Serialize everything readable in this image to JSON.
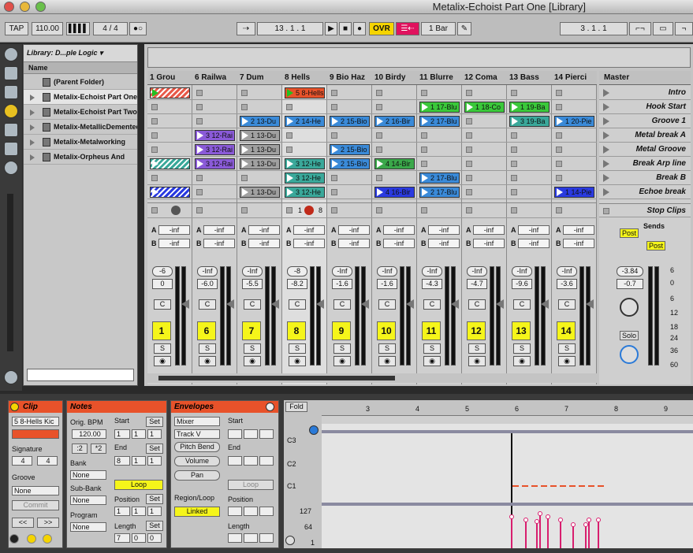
{
  "window": {
    "title": "Metalix-Echoist Part One  [Library]"
  },
  "control": {
    "tap": "TAP",
    "bpm": "110.00",
    "sig": "4 / 4",
    "position": "13 .  1 .  1",
    "ovr": "OVR",
    "quant": "1 Bar",
    "loop_pos": "3 .  1 .  1",
    "colors": {
      "ovr": "#f5d400",
      "rec": "#e0125e"
    }
  },
  "library": {
    "title": "Library: D...ple Logic",
    "column": "Name",
    "items": [
      "(Parent Folder)",
      "Metalix-Echoist Part One",
      "Metalix-Echoist Part Two",
      "Metalix-MetallicDemented",
      "Metalix-Metalworking",
      "Metalix-Orpheus And"
    ]
  },
  "tracks": [
    {
      "name": "1 Grou",
      "num": "1",
      "vol": "-6",
      "pan": "0",
      "clips": [
        {
          "t": "",
          "c": "#e85a4a",
          "hatch": true,
          "playing": true
        },
        null,
        null,
        null,
        null,
        {
          "t": "",
          "c": "#3aa89a",
          "hatch": true
        },
        null,
        {
          "t": "",
          "c": "#2a3ae0",
          "hatch": true
        }
      ]
    },
    {
      "name": "6 Railwa",
      "num": "6",
      "vol": "-Inf",
      "pan": "-6.0",
      "clips": [
        null,
        null,
        null,
        {
          "t": "3 12-Rai",
          "c": "#8a5ad8"
        },
        {
          "t": "3 12-Rai",
          "c": "#8a5ad8"
        },
        {
          "t": "3 12-Rai",
          "c": "#8a5ad8"
        },
        null,
        null
      ]
    },
    {
      "name": "7 Dum",
      "num": "7",
      "vol": "-Inf",
      "pan": "-5.5",
      "clips": [
        null,
        null,
        {
          "t": "2 13-Du",
          "c": "#3a8ad8"
        },
        {
          "t": "1 13-Du",
          "c": "#a0a0a0"
        },
        {
          "t": "1 13-Du",
          "c": "#a0a0a0"
        },
        {
          "t": "1 13-Du",
          "c": "#a0a0a0"
        },
        null,
        {
          "t": "1 13-Du",
          "c": "#a0a0a0"
        }
      ]
    },
    {
      "name": "8 Hells",
      "num": "8",
      "vol": "-8",
      "pan": "-8.2",
      "clips": [
        {
          "t": "5 8-Hells",
          "c": "#e8522a",
          "playing": true
        },
        null,
        {
          "t": "2 14-He",
          "c": "#3a8ad8"
        },
        null,
        null,
        {
          "t": "3 12-He",
          "c": "#3aa89a"
        },
        {
          "t": "3 12-He",
          "c": "#3aa89a"
        },
        {
          "t": "3 12-He",
          "c": "#3aa89a"
        }
      ]
    },
    {
      "name": "9 Bio Haz",
      "num": "9",
      "vol": "-Inf",
      "pan": "-1.6",
      "clips": [
        null,
        null,
        {
          "t": "2 15-Bio",
          "c": "#3a8ad8"
        },
        null,
        {
          "t": "2 15-Bio",
          "c": "#3a8ad8"
        },
        {
          "t": "2 15-Bio",
          "c": "#3a8ad8"
        },
        null,
        null
      ]
    },
    {
      "name": "10 Birdy",
      "num": "10",
      "vol": "-Inf",
      "pan": "-1.6",
      "clips": [
        null,
        null,
        {
          "t": "2 16-Bir",
          "c": "#3a8ad8"
        },
        null,
        null,
        {
          "t": "4 14-Bir",
          "c": "#3aa84a"
        },
        null,
        {
          "t": "4 16-Bir",
          "c": "#2a3ae0"
        }
      ]
    },
    {
      "name": "11 Blurre",
      "num": "11",
      "vol": "-Inf",
      "pan": "-4.3",
      "clips": [
        null,
        {
          "t": "1 17-Blu",
          "c": "#3ac83a"
        },
        {
          "t": "2 17-Blu",
          "c": "#3a8ad8"
        },
        null,
        null,
        null,
        {
          "t": "2 17-Blu",
          "c": "#3a8ad8"
        },
        {
          "t": "2 17-Blu",
          "c": "#3a8ad8"
        }
      ]
    },
    {
      "name": "12 Coma",
      "num": "12",
      "vol": "-Inf",
      "pan": "-4.7",
      "clips": [
        null,
        {
          "t": "1 18-Co",
          "c": "#3ac83a"
        },
        null,
        null,
        null,
        null,
        null,
        null
      ]
    },
    {
      "name": "13 Bass",
      "num": "13",
      "vol": "-Inf",
      "pan": "-9.6",
      "clips": [
        null,
        {
          "t": "1 19-Ba",
          "c": "#3ac83a"
        },
        {
          "t": "3 19-Ba",
          "c": "#3aa89a"
        },
        null,
        null,
        null,
        null,
        null
      ]
    },
    {
      "name": "14 Pierci",
      "num": "14",
      "vol": "-Inf",
      "pan": "-3.6",
      "clips": [
        null,
        null,
        {
          "t": "1 20-Pie",
          "c": "#3a8ad8"
        },
        null,
        null,
        null,
        null,
        {
          "t": "1 14-Pie",
          "c": "#2a3ae0"
        }
      ]
    }
  ],
  "sends": {
    "a": "A",
    "b": "B",
    "value": "-inf",
    "c": "C",
    "s": "S"
  },
  "master": {
    "name": "Master",
    "scenes": [
      "Intro",
      "Hook Start",
      "Groove 1",
      "Metal break A",
      "Metal Groove",
      "Break Arp line",
      "Break B",
      "Echoe break"
    ],
    "stop": "Stop Clips",
    "sends": "Sends",
    "post": "Post",
    "vol": "-3.84",
    "pan": "-0.7",
    "solo": "Solo",
    "scale": [
      "6",
      "0",
      "6",
      "12",
      "18",
      "24",
      "36",
      "60"
    ]
  },
  "hells_ctrl": {
    "a": "1",
    "b": "8"
  },
  "clip": {
    "title": "Clip",
    "name": "5 8-Hells Kic",
    "sig_label": "Signature",
    "sig_num": "4",
    "sig_den": "4",
    "groove": "Groove",
    "groove_val": "None",
    "commit": "Commit"
  },
  "notes": {
    "title": "Notes",
    "bpm_label": "Orig. BPM",
    "bpm": "120.00",
    "half": ":2",
    "dbl": "*2",
    "bank": "Bank",
    "sub": "Sub-Bank",
    "prog": "Program",
    "none": "None",
    "start": "Start",
    "end": "End",
    "set": "Set",
    "loop": "Loop",
    "position": "Position",
    "length": "Length",
    "s1": "1",
    "e1": "8",
    "l1": "7",
    "z": "0"
  },
  "env": {
    "title": "Envelopes",
    "mixer": "Mixer",
    "track": "Track V",
    "pitch": "Pitch Bend",
    "volume": "Volume",
    "pan": "Pan",
    "region": "Region/Loop",
    "linked": "Linked",
    "start": "Start",
    "end": "End",
    "loop": "Loop",
    "position": "Position",
    "length": "Length"
  },
  "editor": {
    "fold": "Fold",
    "bars": [
      "3",
      "4",
      "5",
      "6",
      "7",
      "8",
      "9"
    ],
    "keys": [
      "C3",
      "C2",
      "C1"
    ],
    "vel": [
      "127",
      "64",
      "1"
    ]
  }
}
